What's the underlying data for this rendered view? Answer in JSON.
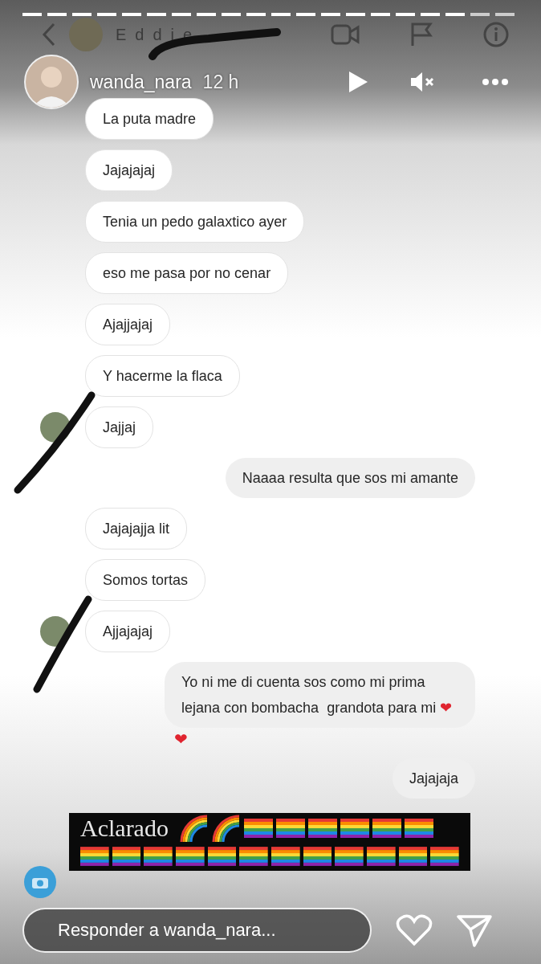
{
  "chat_header": {
    "name": "Eddie"
  },
  "story": {
    "username": "wanda_nara",
    "time": "12 h",
    "muted": true,
    "paused": true
  },
  "messages": [
    {
      "kind": "received",
      "text": "La puta madre",
      "avatar": false
    },
    {
      "kind": "received",
      "text": "Jajajajaj",
      "avatar": false
    },
    {
      "kind": "received",
      "text": "Tenia un pedo galaxtico ayer",
      "avatar": false
    },
    {
      "kind": "received",
      "text": "eso me pasa por no cenar",
      "avatar": false
    },
    {
      "kind": "received",
      "text": "Ajajjajaj",
      "avatar": false
    },
    {
      "kind": "received",
      "text": "Y hacerme la flaca",
      "avatar": false
    },
    {
      "kind": "received",
      "text": "Jajjaj",
      "avatar": true
    },
    {
      "kind": "sent",
      "text": "Naaaa resulta que sos mi amante"
    },
    {
      "kind": "received",
      "text": "Jajajajja lit",
      "avatar": false
    },
    {
      "kind": "received",
      "text": "Somos tortas",
      "avatar": false
    },
    {
      "kind": "received",
      "text": "Ajjajajaj",
      "avatar": true
    },
    {
      "kind": "sent",
      "text": "Yo ni me di cuenta sos como mi prima lejana con bombacha  grandota para mi",
      "emoji": "❤",
      "reaction": "❤"
    },
    {
      "kind": "sent",
      "text": "Jajajaja"
    }
  ],
  "sticker": {
    "text": "Aclarado"
  },
  "reply": {
    "placeholder": "Responder a wanda_nara..."
  }
}
